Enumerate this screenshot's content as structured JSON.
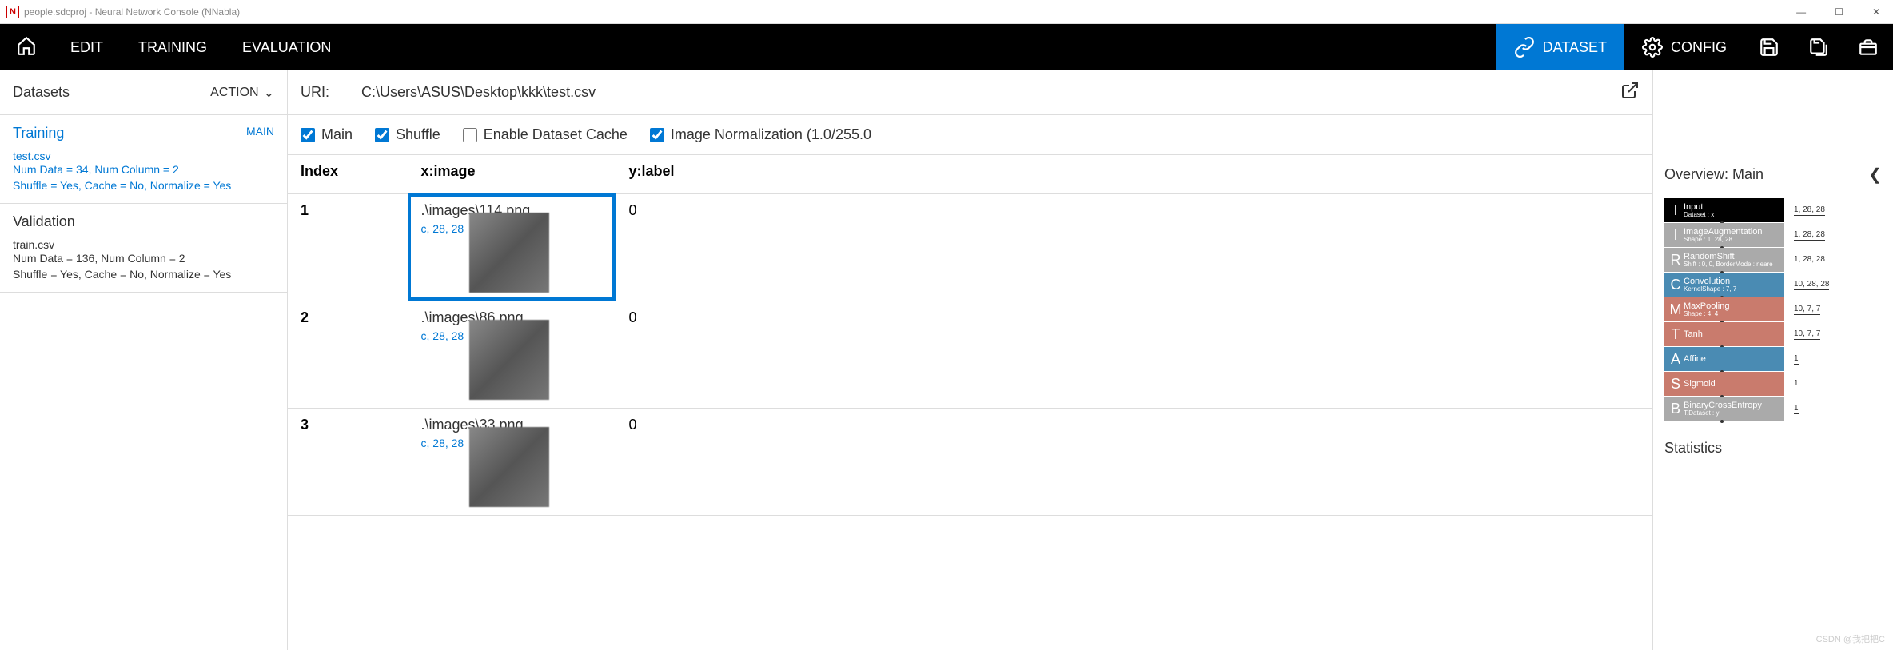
{
  "titlebar": {
    "icon_letter": "N",
    "title": "people.sdcproj - Neural Network Console (NNabla)"
  },
  "topnav": {
    "edit": "EDIT",
    "training": "TRAINING",
    "evaluation": "EVALUATION",
    "dataset": "DATASET",
    "config": "CONFIG"
  },
  "sidebar": {
    "title": "Datasets",
    "action": "ACTION",
    "sections": [
      {
        "name": "Training",
        "badge": "MAIN",
        "file": "test.csv",
        "meta1": "Num Data = 34, Num Column = 2",
        "meta2": "Shuffle = Yes, Cache = No, Normalize = Yes"
      },
      {
        "name": "Validation",
        "badge": "",
        "file": "train.csv",
        "meta1": "Num Data = 136, Num Column = 2",
        "meta2": "Shuffle = Yes, Cache = No, Normalize = Yes"
      }
    ]
  },
  "uribar": {
    "label": "URI:",
    "path": "C:\\Users\\ASUS\\Desktop\\kkk\\test.csv"
  },
  "options": {
    "main": "Main",
    "shuffle": "Shuffle",
    "cache": "Enable Dataset Cache",
    "normalize": "Image Normalization (1.0/255.0"
  },
  "table": {
    "col_index": "Index",
    "col_x": "x:image",
    "col_y": "y:label",
    "rows": [
      {
        "index": "1",
        "fname": ".\\images\\114.png",
        "shape": "c, 28, 28",
        "y": "0"
      },
      {
        "index": "2",
        "fname": ".\\images\\86.png",
        "shape": "c, 28, 28",
        "y": "0"
      },
      {
        "index": "3",
        "fname": ".\\images\\33.png",
        "shape": "c, 28, 28",
        "y": "0"
      }
    ]
  },
  "overview": {
    "title": "Overview: Main",
    "layers": [
      {
        "letter": "I",
        "name": "Input",
        "sub": "Dataset : x",
        "shape": "1, 28, 28",
        "color": "c-black"
      },
      {
        "letter": "I",
        "name": "ImageAugmentation",
        "sub": "Shape : 1, 28, 28",
        "shape": "1, 28, 28",
        "color": "c-gray"
      },
      {
        "letter": "R",
        "name": "RandomShift",
        "sub": "Shift : 0, 0, BorderMode : neare",
        "shape": "1, 28, 28",
        "color": "c-gray"
      },
      {
        "letter": "C",
        "name": "Convolution",
        "sub": "KernelShape : 7, 7",
        "shape": "10, 28, 28",
        "color": "c-blue"
      },
      {
        "letter": "M",
        "name": "MaxPooling",
        "sub": "Shape : 4, 4",
        "shape": "10, 7, 7",
        "color": "c-red"
      },
      {
        "letter": "T",
        "name": "Tanh",
        "sub": "",
        "shape": "10, 7, 7",
        "color": "c-red"
      },
      {
        "letter": "A",
        "name": "Affine",
        "sub": "",
        "shape": "1",
        "color": "c-blue"
      },
      {
        "letter": "S",
        "name": "Sigmoid",
        "sub": "",
        "shape": "1",
        "color": "c-red"
      },
      {
        "letter": "B",
        "name": "BinaryCrossEntropy",
        "sub": "T.Dataset : y",
        "shape": "1",
        "color": "c-gray"
      }
    ],
    "stats": "Statistics"
  },
  "watermark": "CSDN @我把把C"
}
